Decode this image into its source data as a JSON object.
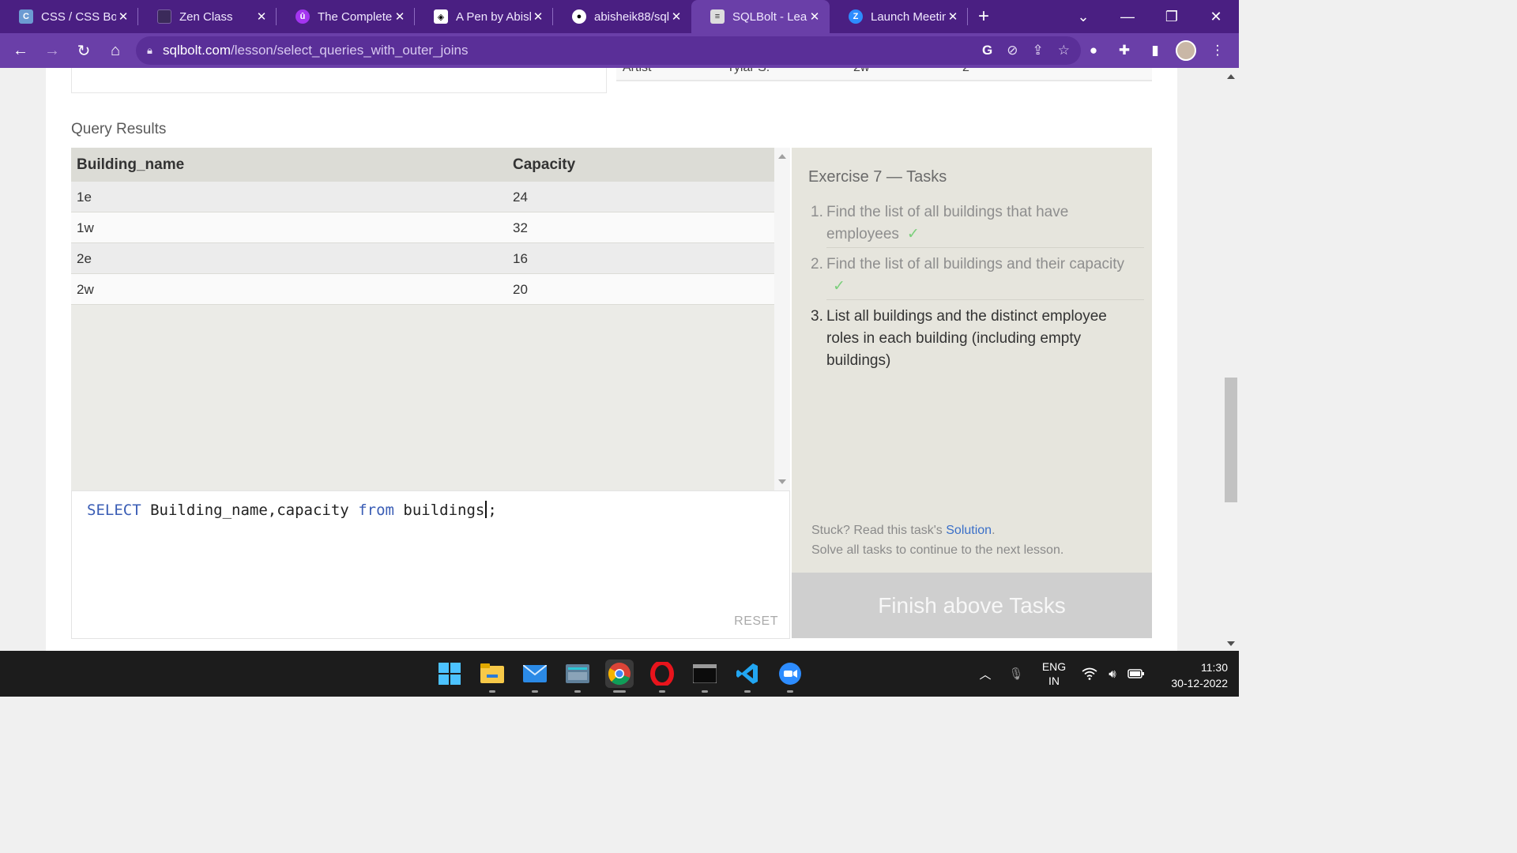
{
  "browser": {
    "tabs": [
      {
        "label": "CSS / CSS Box",
        "favicon": "css-icon",
        "color": "#6c9bd2",
        "active": false
      },
      {
        "label": "Zen Class",
        "favicon": "zen-icon",
        "color": "#3b2a5a",
        "active": false
      },
      {
        "label": "The Complete",
        "favicon": "udemy-icon",
        "color": "#a435f0",
        "active": false
      },
      {
        "label": "A Pen by Abish",
        "favicon": "codepen-icon",
        "color": "#ffffff",
        "active": false
      },
      {
        "label": "abisheik88/sql",
        "favicon": "github-icon",
        "color": "#ffffff",
        "active": false
      },
      {
        "label": "SQLBolt - Learn",
        "favicon": "database-icon",
        "color": "#dddddd",
        "active": true
      },
      {
        "label": "Launch Meetin",
        "favicon": "zoom-icon",
        "color": "#2d8cff",
        "active": false
      }
    ],
    "url_host": "sqlbolt.com",
    "url_path": "/lesson/select_queries_with_outer_joins"
  },
  "page": {
    "top_table_fragments": [
      "Artist",
      "Tylar S.",
      "2w",
      "2"
    ],
    "query_results_title": "Query Results",
    "results": {
      "columns": [
        "Building_name",
        "Capacity"
      ],
      "rows": [
        [
          "1e",
          "24"
        ],
        [
          "1w",
          "32"
        ],
        [
          "2e",
          "16"
        ],
        [
          "2w",
          "20"
        ]
      ]
    },
    "editor": {
      "kw_select": "SELECT",
      "part1": " Building_name,capacity ",
      "kw_from": "from",
      "part2": " buildings",
      "part3": ";",
      "reset_label": "RESET"
    },
    "tasks": {
      "title": "Exercise 7 — Tasks",
      "items": [
        {
          "num": "1.",
          "text": "Find the list of all buildings that have employees",
          "done": true
        },
        {
          "num": "2.",
          "text": "Find the list of all buildings and their capacity",
          "done": true
        },
        {
          "num": "3.",
          "text": "List all buildings and the distinct employee roles in each building (including empty buildings)",
          "done": false
        }
      ],
      "check_mark": "✓",
      "hint_prefix": "Stuck? Read this task's ",
      "hint_link": "Solution",
      "hint_suffix": ".",
      "hint_line2": "Solve all tasks to continue to the next lesson.",
      "finish_label": "Finish above Tasks"
    }
  },
  "taskbar": {
    "lang_line1": "ENG",
    "lang_line2": "IN",
    "time": "11:30",
    "date": "30-12-2022"
  }
}
